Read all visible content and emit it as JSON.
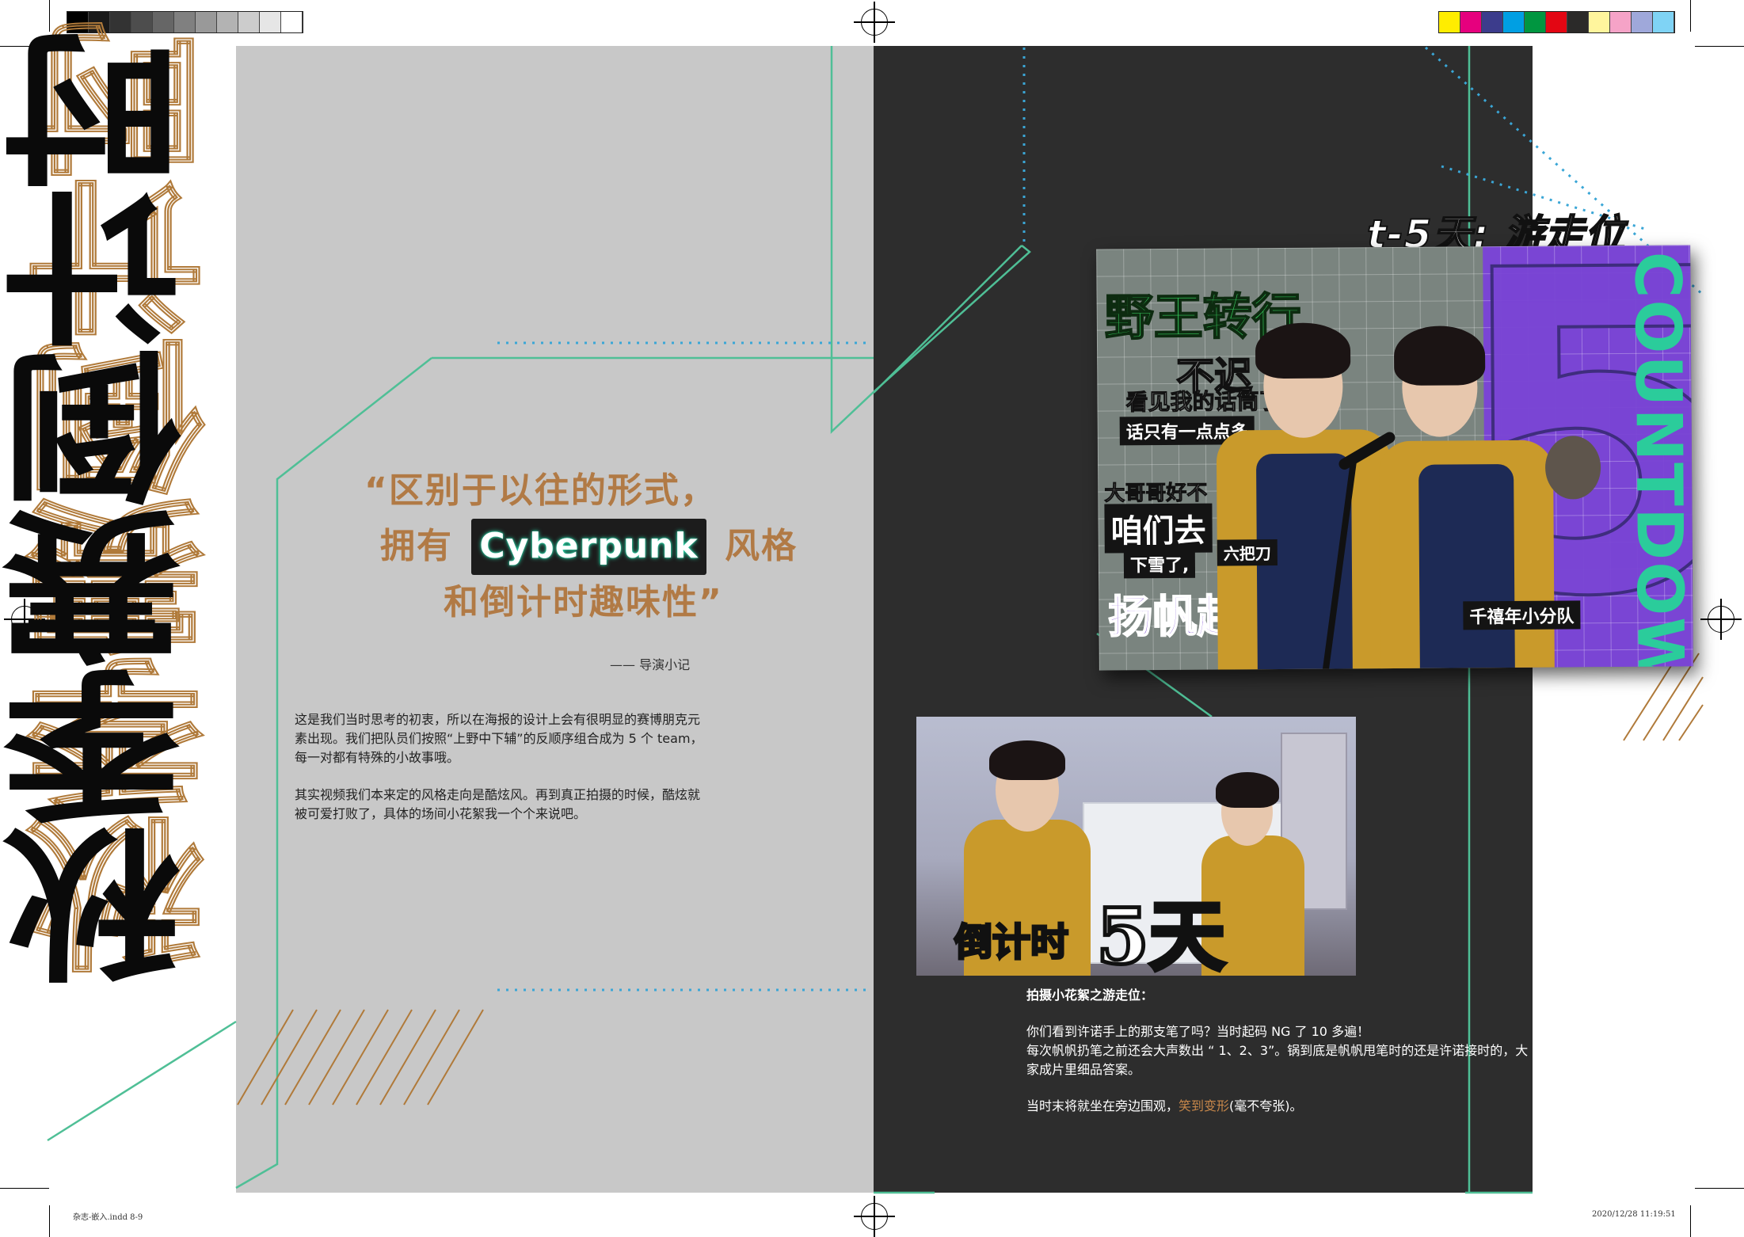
{
  "print_marks": {
    "grayscale": [
      "#000000",
      "#1a1a1a",
      "#333333",
      "#4d4d4d",
      "#666666",
      "#808080",
      "#999999",
      "#b3b3b3",
      "#cccccc",
      "#e6e6e6",
      "#ffffff"
    ],
    "color_bar": [
      "#ffed00",
      "#e6007e",
      "#3c3c8c",
      "#009fe3",
      "#009640",
      "#e30613",
      "#2b2a29",
      "#fff59d",
      "#f5a3c7",
      "#9fa8da",
      "#7fd3f5"
    ]
  },
  "title": "秋季赛倒计时",
  "quote": {
    "line1": "“区别于以往的形式，",
    "line2_before": "拥有",
    "line2_highlight": "Cyberpunk",
    "line2_after": "风格",
    "line3": "和倒计时趣味性”",
    "author": "—— 导演小记"
  },
  "body": {
    "para1": "这是我们当时思考的初衷，所以在海报的设计上会有很明显的赛博朋克元素出现。我们把队员们按照“上野中下辅”的反顺序组合成为 5 个 team，每一对都有特殊的小故事哦。",
    "para2": "其实视频我们本来定的风格走向是酷炫风。再到真正拍摄的时候，酷炫就被可爱打败了，具体的场间小花絮我一个个来说吧。"
  },
  "poster": {
    "heading": "t-5天: 游走位",
    "big_number": "5",
    "vertical_text": "COUNTDOWN",
    "text_1": "野王转行",
    "text_2": "不迟",
    "text_3": "看见我的话筒了",
    "text_4": "话只有一点点多",
    "text_5": "大哥哥好不",
    "text_6": "咱们去",
    "text_7": "下雪了,",
    "text_8": "扬帆起",
    "label_left": "六把刀",
    "label_right": "千禧年小分队"
  },
  "photo": {
    "caption_small": "倒计时",
    "caption_big": "5天"
  },
  "right_text": {
    "heading": "拍摄小花絮之游走位：",
    "p1_line1": "你们看到许诺手上的那支笔了吗？当时起码 NG 了 10 多遍！",
    "p1_line2": "每次帆帆扔笔之前还会大声数出 “ 1、2、3”。锅到底是帆帆甩笔时的还是许诺接时的，大家成片里细品答案。",
    "p2_before": "当时末将就坐在旁边围观，",
    "p2_highlight": "笑到变形",
    "p2_after": "(毫不夸张)。"
  },
  "footer": {
    "left": "杂志-嵌入.indd   8-9",
    "right": "2020/12/28   11:19:51"
  },
  "colors": {
    "left_panel": "#c8c8c8",
    "right_panel": "#2d2d2d",
    "accent_teal": "#4fbf96",
    "accent_gold": "#b17a45",
    "accent_purple": "#7a45d4",
    "dotted_blue": "#3aa6d6"
  }
}
